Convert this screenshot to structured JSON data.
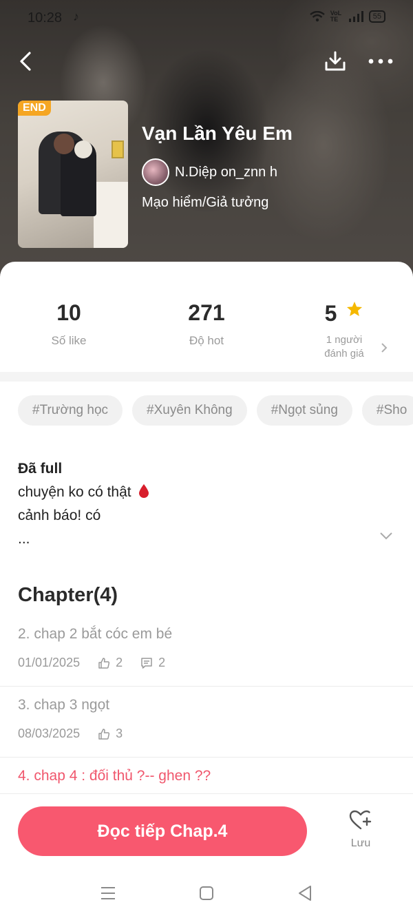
{
  "status_bar": {
    "time": "10:28",
    "network": "VoLTE",
    "battery": "55"
  },
  "story": {
    "badge": "END",
    "title": "Vạn Lần Yêu Em",
    "author": "N.Diệp on_znn h",
    "genre": "Mạo hiểm/Giả tưởng"
  },
  "stats": {
    "likes": {
      "value": "10",
      "label": "Số like"
    },
    "hot": {
      "value": "271",
      "label": "Độ hot"
    },
    "rating": {
      "value": "5",
      "label_line1": "1 người",
      "label_line2": "đánh giá"
    }
  },
  "tags": [
    "#Trường học",
    "#Xuyên Không",
    "#Ngọt sủng",
    "#Sho"
  ],
  "description": {
    "line1": "Đã full",
    "line2": "chuyện ko có thật",
    "line3": "cảnh báo! có",
    "line4": "..."
  },
  "chapters_heading": "Chapter(4)",
  "chapters": [
    {
      "title": "2. chap 2 bắt cóc em bé",
      "date": "01/01/2025",
      "likes": "2",
      "comments": "2"
    },
    {
      "title": "3. chap 3 ngọt",
      "date": "08/03/2025",
      "likes": "3"
    },
    {
      "title": "4. chap 4 : đối thủ ?-- ghen ??"
    }
  ],
  "actions": {
    "read_label": "Đọc tiếp Chap.4",
    "save_label": "Lưu"
  },
  "colors": {
    "accent": "#f8586f",
    "star": "#f5b800",
    "end_badge": "#f5a623"
  }
}
